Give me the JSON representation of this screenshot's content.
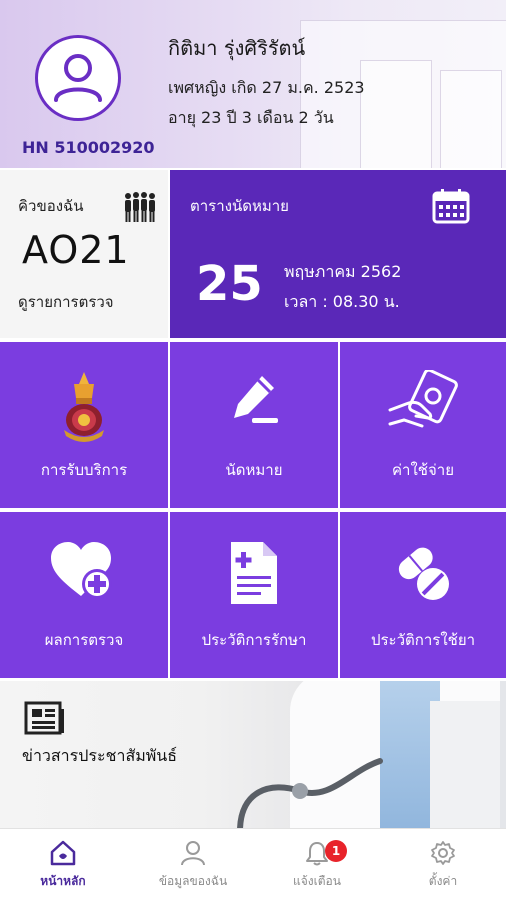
{
  "patient": {
    "name": "กิติมา รุ่งศิริรัตน์",
    "info_line1": "เพศหญิง เกิด 27 ม.ค. 2523",
    "info_line2": "อายุ 23 ปี 3 เดือน 2 วัน",
    "hn": "HN 510002920"
  },
  "queue": {
    "label": "คิวของฉัน",
    "number": "AO21",
    "detail_link": "ดูรายการตรวจ"
  },
  "appointment": {
    "label": "ตารางนัดหมาย",
    "day": "25",
    "month_year": "พฤษภาคม 2562",
    "time": "เวลา : 08.30 น."
  },
  "menu": [
    {
      "label": "การรับบริการ",
      "icon": "hospital-emblem-icon"
    },
    {
      "label": "นัดหมาย",
      "icon": "pen-sign-icon"
    },
    {
      "label": "ค่าใช้จ่าย",
      "icon": "payment-hand-icon"
    },
    {
      "label": "ผลการตรวจ",
      "icon": "heart-plus-icon"
    },
    {
      "label": "ประวัติการรักษา",
      "icon": "medical-document-icon"
    },
    {
      "label": "ประวัติการใช้ยา",
      "icon": "pills-icon"
    }
  ],
  "news": {
    "label": "ข่าวสารประชาสัมพันธ์",
    "icon": "newspaper-icon"
  },
  "nav": {
    "items": [
      {
        "label": "หน้าหลัก",
        "icon": "home-icon",
        "active": true
      },
      {
        "label": "ข้อมูลของฉัน",
        "icon": "user-icon",
        "active": false
      },
      {
        "label": "แจ้งเตือน",
        "icon": "bell-icon",
        "active": false
      },
      {
        "label": "ตั้งค่า",
        "icon": "gear-icon",
        "active": false
      }
    ],
    "notification_badge": "1"
  },
  "colors": {
    "primary": "#7b3de0",
    "appointment_bg": "#5a28b8",
    "hn_text": "#3e2496",
    "badge": "#e8232a"
  }
}
